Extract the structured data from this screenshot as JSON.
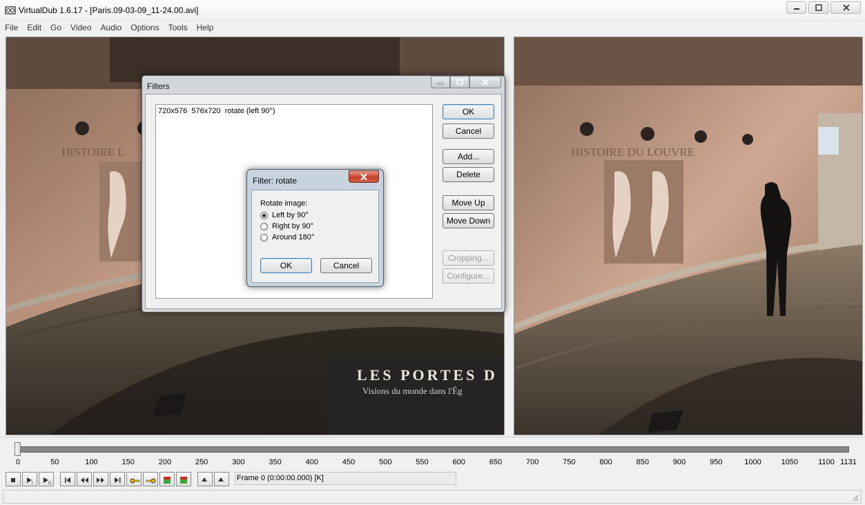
{
  "window": {
    "title": "VirtualDub 1.6.17 - [Paris.09-03-09_11-24.00.avi]",
    "buttons": [
      "minimize-icon",
      "maximize-icon",
      "close-icon"
    ]
  },
  "menu": [
    "File",
    "Edit",
    "Go",
    "Video",
    "Audio",
    "Options",
    "Tools",
    "Help"
  ],
  "panes": {
    "input_overlay_text": [
      "LES PORTES D",
      "Visions du monde dans l'Ég"
    ],
    "wall_text_left": "HISTOIRE L",
    "wall_text_right": "HISTOIRE DU LOUVRE"
  },
  "filters_dialog": {
    "title": "Filters",
    "entries": [
      {
        "size_in": "720x576",
        "size_out": "576x720",
        "name": "rotate (left 90°)"
      }
    ],
    "buttons": {
      "ok": "OK",
      "cancel": "Cancel",
      "add": "Add...",
      "delete": "Delete",
      "move_up": "Move Up",
      "move_down": "Move Down",
      "cropping": "Cropping...",
      "configure": "Configure..."
    }
  },
  "rotate_dialog": {
    "title": "Filter: rotate",
    "group_label": "Rotate image:",
    "options": [
      "Left by 90°",
      "Right by 90°",
      "Around 180°"
    ],
    "selected": "Left by 90°",
    "ok": "OK",
    "cancel": "Cancel"
  },
  "timeline": {
    "ticks": [
      "0",
      "50",
      "100",
      "150",
      "200",
      "250",
      "300",
      "350",
      "400",
      "450",
      "500",
      "550",
      "600",
      "650",
      "700",
      "750",
      "800",
      "850",
      "900",
      "950",
      "1000",
      "1050",
      "1100",
      "1131"
    ],
    "current_frame": 0,
    "total_frames": 1131,
    "frame_readout": "Frame 0 (0:00:00.000) [K]",
    "toolbar_icons": [
      "stop-icon",
      "play-input-icon",
      "play-output-icon",
      "go-start-icon",
      "step-back-icon",
      "step-forward-icon",
      "go-end-icon",
      "prev-key-icon",
      "next-key-icon",
      "scene-back-icon",
      "scene-forward-icon",
      "mark-in-icon",
      "mark-out-icon"
    ]
  }
}
